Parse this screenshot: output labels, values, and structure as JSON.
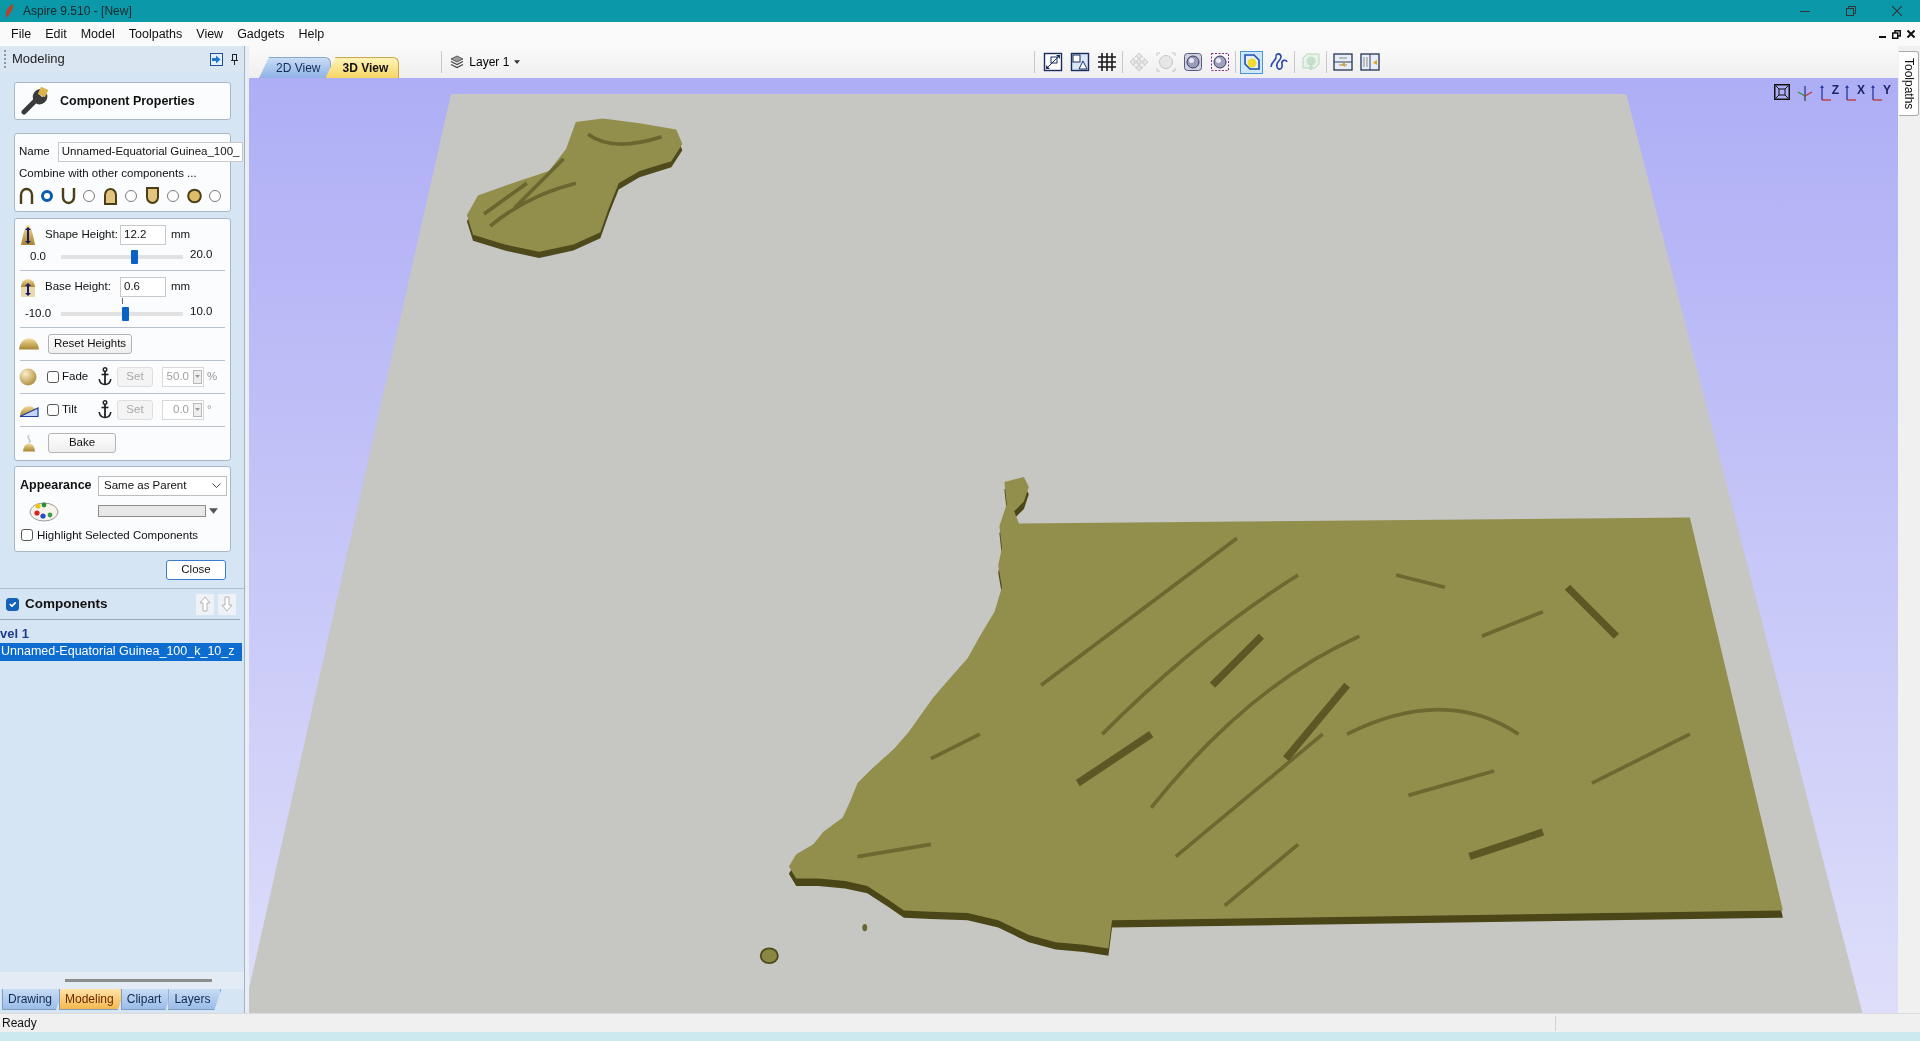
{
  "window": {
    "title": "Aspire 9.510 - [New]"
  },
  "menu": [
    {
      "label": "File"
    },
    {
      "label": "Edit"
    },
    {
      "label": "Model"
    },
    {
      "label": "Toolpaths"
    },
    {
      "label": "View"
    },
    {
      "label": "Gadgets"
    },
    {
      "label": "Help"
    }
  ],
  "panel": {
    "title": "Modeling",
    "heading": "Component Properties",
    "name": {
      "label": "Name",
      "value": "Unnamed-Equatorial Guinea_100_"
    },
    "combine": {
      "label": "Combine with other components ...",
      "modes": [
        {
          "kind": "arch",
          "selected": true
        },
        {
          "kind": "cup",
          "selected": false
        },
        {
          "kind": "arch-filled",
          "selected": false
        },
        {
          "kind": "cup-filled",
          "selected": false
        },
        {
          "kind": "disc",
          "selected": false
        }
      ]
    },
    "heights": [
      {
        "kind": "shape",
        "label": "Shape Height:",
        "value": "12.2",
        "unit": "mm",
        "min": "0.0",
        "max": "20.0",
        "level": 0.61
      },
      {
        "kind": "base",
        "label": "Base Height:",
        "value": "0.6",
        "unit": "mm",
        "min": "-10.0",
        "max": "10.0",
        "level": 0.53
      }
    ],
    "reset_button": "Reset Heights",
    "adjustments": [
      {
        "kind": "fade",
        "label": "Fade",
        "checked": false,
        "set_label": "Set",
        "value": "50.0",
        "unit": "%",
        "disabled": true
      },
      {
        "kind": "tilt",
        "label": "Tilt",
        "checked": false,
        "set_label": "Set",
        "value": "0.0",
        "unit": "°",
        "disabled": true
      }
    ],
    "bake_button": "Bake",
    "appearance": {
      "label": "Appearance",
      "value": "Same as Parent",
      "highlight": {
        "label": "Highlight Selected Components",
        "checked": false
      }
    },
    "close_button": "Close"
  },
  "components": {
    "title": "Components",
    "checked": true,
    "move_buttons": [
      {
        "kind": "up",
        "disabled": true
      },
      {
        "kind": "down",
        "disabled": true
      }
    ],
    "tree": [
      {
        "label": "vel 1",
        "selected": false,
        "children": [
          {
            "label": "Unnamed-Equatorial Guinea_100_k_10_z",
            "selected": true
          }
        ]
      }
    ]
  },
  "panel_tabs": [
    {
      "label": "Drawing",
      "selected": false
    },
    {
      "label": "Modeling",
      "selected": true
    },
    {
      "label": "Clipart",
      "selected": false
    },
    {
      "label": "Layers",
      "selected": false
    }
  ],
  "view_tabs": [
    {
      "label": "2D View",
      "selected": false
    },
    {
      "label": "3D View",
      "selected": true
    }
  ],
  "layer": {
    "label": "Layer 1"
  },
  "toolbar": [
    [
      {
        "kind": "frame-arrow",
        "disabled": false,
        "selected": false
      },
      {
        "kind": "square-triangle",
        "disabled": false,
        "selected": false
      },
      {
        "kind": "grid",
        "disabled": false,
        "selected": false
      }
    ],
    [
      {
        "kind": "move",
        "disabled": true,
        "selected": false
      },
      {
        "kind": "zoom-box",
        "disabled": true,
        "selected": false
      },
      {
        "kind": "zoom-round",
        "disabled": false,
        "selected": false
      },
      {
        "kind": "zoom-dashed",
        "disabled": false,
        "selected": false
      }
    ],
    [
      {
        "kind": "render",
        "disabled": false,
        "selected": true
      },
      {
        "kind": "squiggle",
        "disabled": false,
        "selected": false
      }
    ],
    [
      {
        "kind": "relief",
        "disabled": true,
        "selected": false
      }
    ],
    [
      {
        "kind": "split-h",
        "disabled": false,
        "selected": false
      },
      {
        "kind": "split-v",
        "disabled": false,
        "selected": false
      }
    ]
  ],
  "view_buttons": [
    {
      "kind": "fit"
    },
    {
      "kind": "iso"
    },
    {
      "kind": "axis",
      "label": "Z"
    },
    {
      "kind": "axis",
      "label": "X"
    },
    {
      "kind": "axis",
      "label": "Y"
    }
  ],
  "side_tabs": [
    {
      "label": "Toolpaths"
    }
  ],
  "status_bar": {
    "text": "Ready"
  }
}
